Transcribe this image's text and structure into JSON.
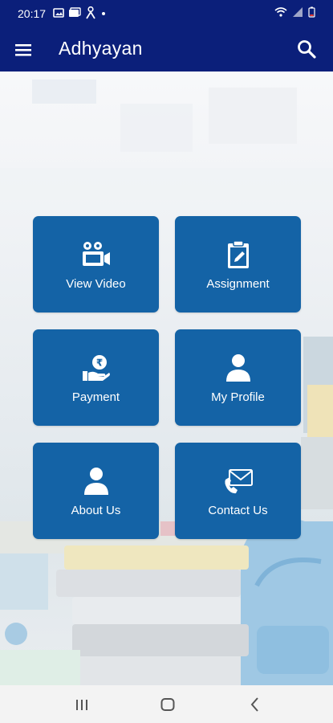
{
  "status_bar": {
    "time": "20:17"
  },
  "app_bar": {
    "title": "Adhyayan"
  },
  "menu": {
    "items": [
      {
        "label": "View Video",
        "icon": "video-camera-icon"
      },
      {
        "label": "Assignment",
        "icon": "clipboard-pencil-icon"
      },
      {
        "label": "Payment",
        "icon": "rupee-payment-icon"
      },
      {
        "label": "My Profile",
        "icon": "user-icon"
      },
      {
        "label": "About Us",
        "icon": "user-icon"
      },
      {
        "label": "Contact Us",
        "icon": "envelope-phone-icon"
      }
    ]
  },
  "colors": {
    "app_bar": "#0b1f7a",
    "card": "#1463a6",
    "card_text": "#ffffff"
  }
}
